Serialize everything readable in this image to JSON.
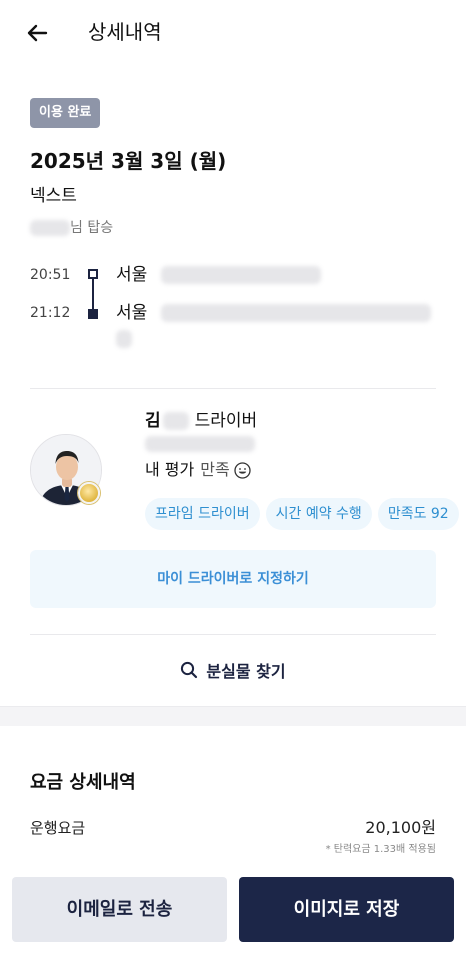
{
  "header": {
    "title": "상세내역"
  },
  "trip": {
    "status_badge": "이용 완료",
    "date": "2025년 3월 3일 (월)",
    "service": "넥스트",
    "rider_suffix": "님 탑승"
  },
  "route": {
    "start": {
      "time": "20:51",
      "place": "서울"
    },
    "end": {
      "time": "21:12",
      "place": "서울"
    }
  },
  "driver": {
    "name_initial": "김",
    "role": "드라이버",
    "rating_label": "내 평가",
    "rating_value": "만족",
    "tags": [
      "프라임 드라이버",
      "시간 예약 수행",
      "만족도 92"
    ]
  },
  "actions": {
    "designate_label": "마이 드라이버로 지정하기",
    "lost_label": "분실물 찾기"
  },
  "fare": {
    "title": "요금 상세내역",
    "label": "운행요금",
    "value": "20,100원",
    "note": "* 탄력요금 1.33배 적용됨"
  },
  "footer": {
    "email_label": "이메일로 전송",
    "image_label": "이미지로 저장"
  },
  "colors": {
    "navy": "#1c2648",
    "badge_gray": "#8e95a8",
    "tag_blue": "#2e8fd0",
    "tag_bg": "#eef7fd"
  }
}
